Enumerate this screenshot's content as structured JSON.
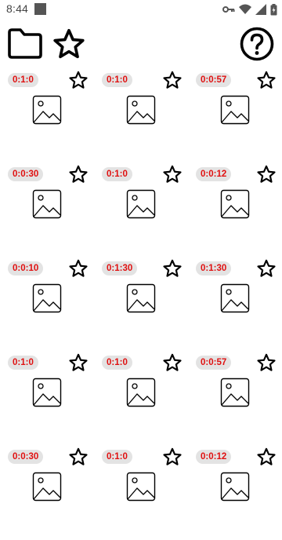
{
  "status_bar": {
    "time": "8:44",
    "icons": [
      "app-notification-icon",
      "vpn-key-icon",
      "wifi-icon",
      "signal-icon",
      "battery-icon"
    ]
  },
  "toolbar": {
    "folder_icon": "folder-icon",
    "favorites_icon": "star-icon",
    "help_icon": "help-icon"
  },
  "colors": {
    "badge_text": "#e01010",
    "badge_bg": "#e3e3e3"
  },
  "grid": {
    "items": [
      {
        "duration": "0:1:0"
      },
      {
        "duration": "0:1:0"
      },
      {
        "duration": "0:0:57"
      },
      {
        "duration": "0:0:30"
      },
      {
        "duration": "0:1:0"
      },
      {
        "duration": "0:0:12"
      },
      {
        "duration": "0:0:10"
      },
      {
        "duration": "0:1:30"
      },
      {
        "duration": "0:1:30"
      },
      {
        "duration": "0:1:0"
      },
      {
        "duration": "0:1:0"
      },
      {
        "duration": "0:0:57"
      },
      {
        "duration": "0:0:30"
      },
      {
        "duration": "0:1:0"
      },
      {
        "duration": "0:0:12"
      }
    ]
  }
}
